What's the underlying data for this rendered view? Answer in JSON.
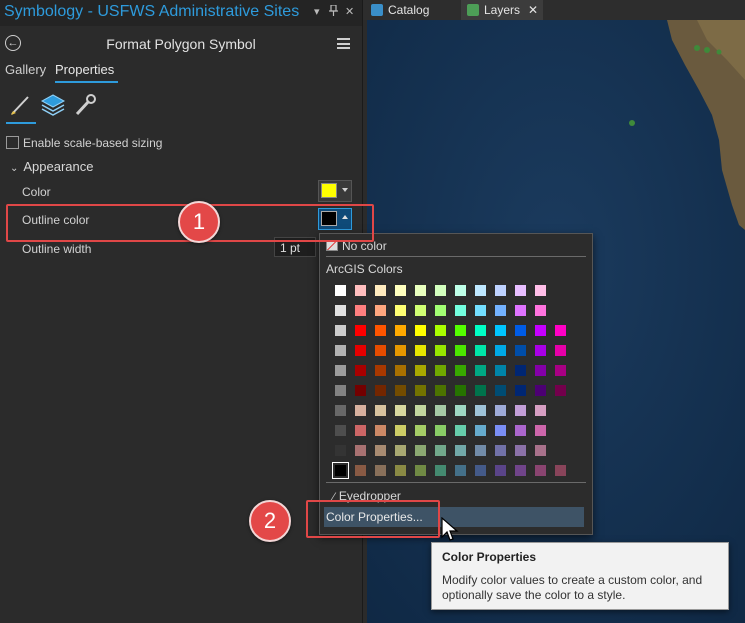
{
  "pane": {
    "title": "Symbology - USFWS Administrative Sites",
    "header_title": "Format Polygon Symbol",
    "tabs": [
      "Gallery",
      "Properties"
    ],
    "active_tab": "Properties",
    "scale_based_sizing": {
      "label": "Enable scale-based sizing",
      "checked": false
    },
    "section": "Appearance",
    "props": {
      "color_label": "Color",
      "color_value": "#ffff00",
      "outline_label": "Outline color",
      "outline_value": "#000000",
      "width_label": "Outline width",
      "width_value": "1 pt"
    }
  },
  "map_tabs": {
    "catalog": "Catalog",
    "layers": "Layers",
    "close_glyph": "✕"
  },
  "dropdown": {
    "no_color": "No color",
    "palette_title": "ArcGIS Colors",
    "eyedropper": "Eyedropper",
    "color_properties": "Color Properties...",
    "palette_rows": [
      [
        "#ffffff",
        "#ffbebe",
        "#ffebbe",
        "#ffffbe",
        "#e9ffbe",
        "#d3ffbe",
        "#beffe8",
        "#bee8ff",
        "#bed2ff",
        "#e8beff",
        "#ffbee8"
      ],
      [
        "#e1e1e1",
        "#ff7f7f",
        "#ffa77f",
        "#ffff73",
        "#d1ff73",
        "#a3ff73",
        "#73ffdf",
        "#73dfff",
        "#73b2ff",
        "#df73ff",
        "#ff73df"
      ],
      [
        "#cccccc",
        "#ff0000",
        "#ff5500",
        "#ffaa00",
        "#ffff00",
        "#aaff00",
        "#55ff00",
        "#00ffc5",
        "#00c5ff",
        "#005ce6",
        "#c500ff",
        "#ff00c5"
      ],
      [
        "#b2b2b2",
        "#e60000",
        "#e64c00",
        "#e69800",
        "#e6e600",
        "#98e600",
        "#4ce600",
        "#00e6a9",
        "#00a9e6",
        "#004da8",
        "#a900e6",
        "#e600a9"
      ],
      [
        "#9c9c9c",
        "#a80000",
        "#a83800",
        "#a87000",
        "#a8a800",
        "#70a800",
        "#38a800",
        "#00a884",
        "#0084a8",
        "#002673",
        "#8400a8",
        "#a80084"
      ],
      [
        "#828282",
        "#730000",
        "#732600",
        "#734c00",
        "#737300",
        "#4c7300",
        "#267300",
        "#00734c",
        "#004c73",
        "#002673",
        "#4c0073",
        "#73004c"
      ],
      [
        "#686868",
        "#d7b09e",
        "#d7c29e",
        "#d7d79e",
        "#c2d69e",
        "#a5c9a5",
        "#9ed7c2",
        "#9ec2d7",
        "#9eaad7",
        "#c29ed7",
        "#d69ec2"
      ],
      [
        "#4e4e4e",
        "#cd6666",
        "#cd8966",
        "#cdcd66",
        "#a5cd66",
        "#89cd66",
        "#66cdab",
        "#66abcd",
        "#7a8ef5",
        "#ab66cd",
        "#cd66ab"
      ],
      [
        "#343434",
        "#a87171",
        "#a88b71",
        "#a8a871",
        "#8ba871",
        "#71a88b",
        "#71a8a8",
        "#718ba8",
        "#7171a8",
        "#8b71a8",
        "#a8718b"
      ],
      [
        "#000000",
        "#895a44",
        "#89705a",
        "#8a8a44",
        "#708a44",
        "#448a70",
        "#447089",
        "#445a89",
        "#5a4489",
        "#70448a",
        "#8a4470",
        "#89445a"
      ]
    ],
    "selected_color": "#000000"
  },
  "tooltip": {
    "title": "Color Properties",
    "body": "Modify color values to create a custom color, and optionally save the color to a style."
  },
  "callouts": [
    "1",
    "2"
  ],
  "colors": {
    "accent": "#2e9bdc",
    "highlight": "#e04747",
    "map_water": "#16324f"
  }
}
